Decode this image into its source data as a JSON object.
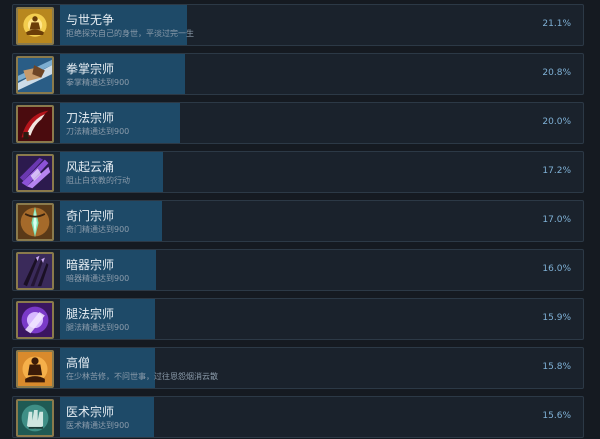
{
  "achievements": [
    {
      "name": "与世无争",
      "description": "拒绝探究自己的身世，平淡过完一生",
      "percent_label": "21.1%",
      "percent": 21.1,
      "icon": "meditating-monk-icon"
    },
    {
      "name": "拳掌宗师",
      "description": "拳掌精通达到900",
      "percent_label": "20.8%",
      "percent": 20.8,
      "icon": "fist-palm-icon"
    },
    {
      "name": "刀法宗师",
      "description": "刀法精通达到900",
      "percent_label": "20.0%",
      "percent": 20.0,
      "icon": "blade-icon"
    },
    {
      "name": "风起云涌",
      "description": "阻止白衣教的行动",
      "percent_label": "17.2%",
      "percent": 17.2,
      "icon": "purple-claws-icon"
    },
    {
      "name": "奇门宗师",
      "description": "奇门精通达到900",
      "percent_label": "17.0%",
      "percent": 17.0,
      "icon": "exotic-weapon-icon"
    },
    {
      "name": "暗器宗师",
      "description": "暗器精通达到900",
      "percent_label": "16.0%",
      "percent": 16.0,
      "icon": "hidden-weapon-icon"
    },
    {
      "name": "腿法宗师",
      "description": "腿法精通达到900",
      "percent_label": "15.9%",
      "percent": 15.9,
      "icon": "kick-icon"
    },
    {
      "name": "高僧",
      "description": "在少林苦修，不问世事，过往恩怨烟消云散",
      "percent_label": "15.8%",
      "percent": 15.8,
      "icon": "monk-silhouette-icon"
    },
    {
      "name": "医术宗师",
      "description": "医术精通达到900",
      "percent_label": "15.6%",
      "percent": 15.6,
      "icon": "medicine-hand-icon"
    }
  ],
  "colors": {
    "background": "#151a21",
    "row_background": "#1a222c",
    "row_border": "#2c3946",
    "progress_fill": "#1e4a68",
    "title_text": "#e6edf3",
    "description_text": "#8c9cab",
    "percent_text": "#7fb1d6"
  }
}
